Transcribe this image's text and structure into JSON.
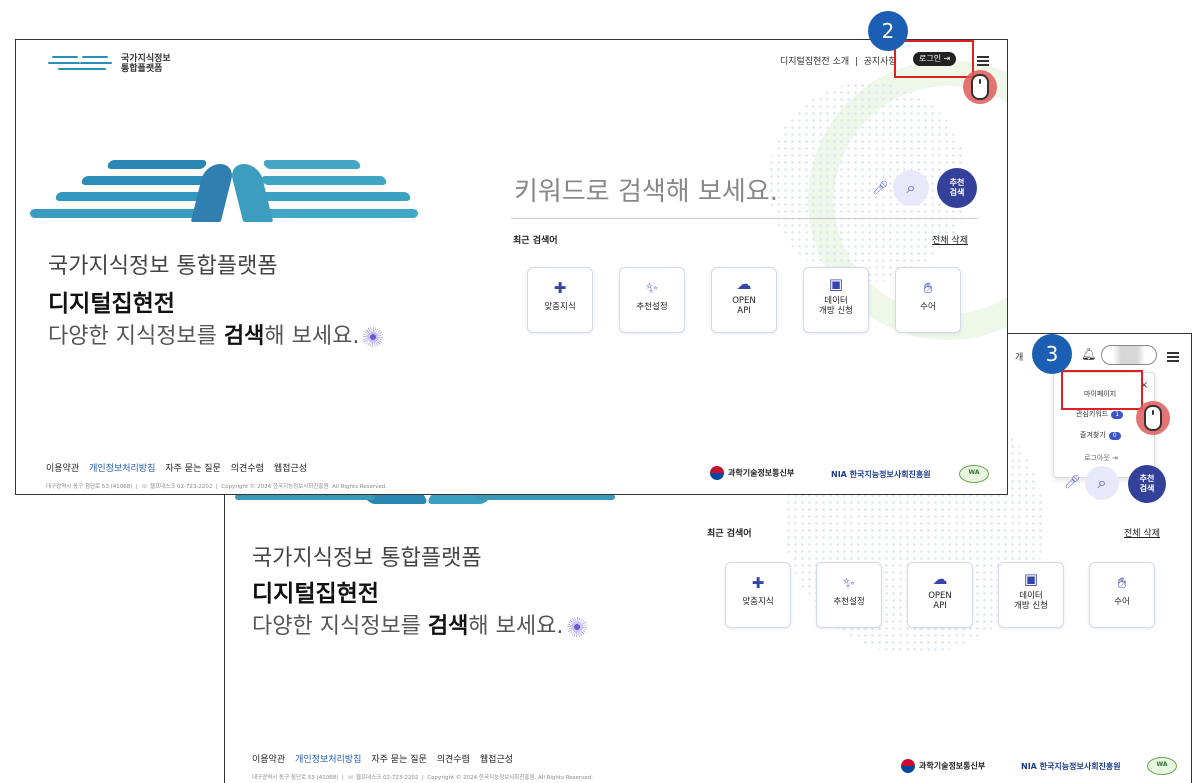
{
  "brand": {
    "line1": "국가지식정보",
    "line2": "통합플랫폼"
  },
  "front": {
    "nav": {
      "intro": "디지털집현전 소개",
      "divider": "|",
      "notice": "공지사항",
      "login": "로그인",
      "login_icon": "login-arrow-icon"
    },
    "hero": {
      "line1": "국가지식정보 통합플랫폼",
      "line2": "디지털집현전",
      "line3_pre": "다양한 지식정보를 ",
      "line3_bold": "검색",
      "line3_post": "해 보세요."
    },
    "search": {
      "placeholder": "키워드로 검색해 보세요.",
      "recommend_line1": "추천",
      "recommend_line2": "검색"
    },
    "recent": {
      "label": "최근 검색어",
      "clear_all": "전체 삭제"
    },
    "cards": [
      {
        "label": "맞춤지식",
        "icon": "puzzle-icon"
      },
      {
        "label": "추천설정",
        "icon": "magic-wand-icon"
      },
      {
        "label": "OPEN\nAPI",
        "icon": "api-cloud-icon"
      },
      {
        "label": "데이터\n개방 신청",
        "icon": "data-folder-icon"
      },
      {
        "label": "수어",
        "icon": "hand-icon"
      }
    ],
    "footer": {
      "links": [
        "이용약관",
        "개인정보처리방침",
        "자주 묻는 질문",
        "의견수렴",
        "웹접근성"
      ],
      "address": "대구광역시 동구 첨단로 53 (41068)",
      "helpdesk": "헬프데스크 02-723-2202",
      "copyright": "Copyright © 2024 한국지능정보사회진흥원. All Rights Reserved.",
      "ministry": "과학기술정보통신부",
      "nia_short": "NIA",
      "nia_full": "한국지능정보사회진흥원",
      "wa_mark": "WA"
    }
  },
  "back": {
    "nav_partial": "개",
    "dropdown": {
      "mypage": "마이페이지",
      "keywords": "관심키워드",
      "keywords_count": "1",
      "favorites": "즐겨찾기",
      "favorites_count": "0",
      "logout": "로그아웃"
    },
    "search": {
      "recommend_line1": "추천",
      "recommend_line2": "검색"
    }
  },
  "steps": {
    "step2": "2",
    "step3": "3"
  },
  "colors": {
    "accent": "#1a5fb4",
    "highlight": "#e02020",
    "brand_teal": "#2a8fb4",
    "navy": "#34409a"
  }
}
